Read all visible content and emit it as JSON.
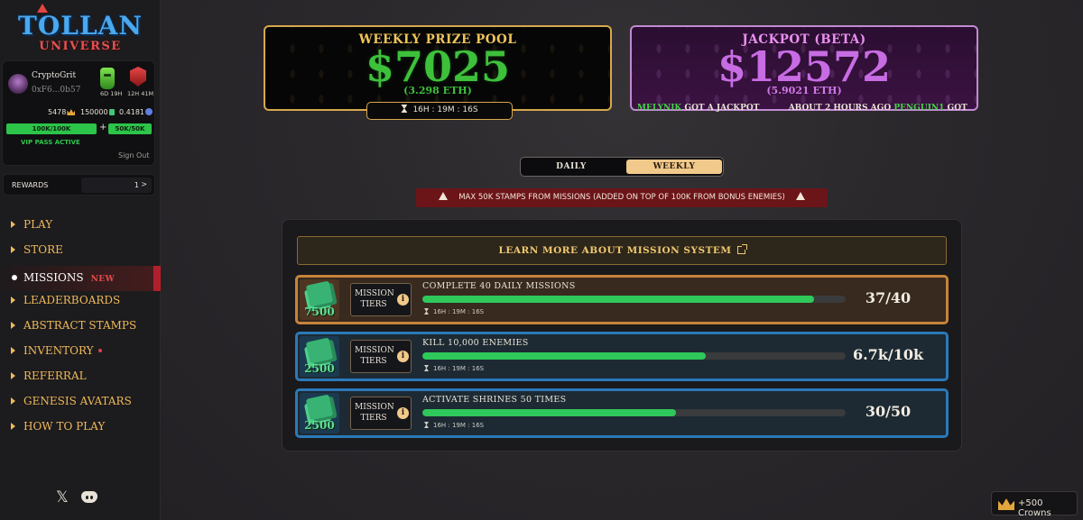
{
  "brand": {
    "title": "TOLLAN",
    "subtitle": "UNIVERSE"
  },
  "profile": {
    "username": "CryptoGrit",
    "wallet": "0xF6...0b57",
    "timer_green": "6D 19H",
    "timer_red": "12H 41M",
    "crowns": "5478",
    "stamps": "150000",
    "eth": "0.4181",
    "stamps_cap_1": "100K/100K",
    "stamps_cap_2": "50K/50K",
    "plus": "+",
    "vip": "VIP PASS ACTIVE",
    "sign_out": "Sign Out"
  },
  "rewards": {
    "label": "REWARDS",
    "count": "1",
    "chevron": ">"
  },
  "nav": {
    "play": "PLAY",
    "store": "STORE",
    "missions": "MISSIONS",
    "missions_badge": "NEW",
    "leaderboards": "LEADERBOARDS",
    "abstract_stamps": "ABSTRACT STAMPS",
    "inventory": "INVENTORY",
    "referral": "REFERRAL",
    "genesis_avatars": "GENESIS AVATARS",
    "how_to_play": "HOW TO PLAY"
  },
  "social": {
    "x": "𝕏"
  },
  "weekly_pool": {
    "title": "WEEKLY PRIZE POOL",
    "amount": "$7025",
    "eth": "(3.298 ETH)",
    "timer": "16H : 19M : 16S"
  },
  "jackpot": {
    "title": "JACKPOT (BETA)",
    "amount": "$12572",
    "eth": "(5.9021 ETH)",
    "ticker_name_1": "MELYNIK",
    "ticker_text_1": " GOT A JACKPOT",
    "ticker_time_1": "ABOUT 2 HOURS AGO",
    "ticker_name_2": "PENGUIN1",
    "ticker_text_2": " GOT"
  },
  "toggle": {
    "daily": "DAILY",
    "weekly": "WEEKLY",
    "selected": "WEEKLY"
  },
  "warning": "MAX 50K STAMPS FROM MISSIONS (ADDED ON TOP OF 100K FROM BONUS ENEMIES)",
  "learn_more": "LEARN MORE ABOUT MISSION SYSTEM",
  "missions": [
    {
      "reward": "7500",
      "tiers_label": "MISSION TIERS",
      "info": "i",
      "title": "COMPLETE 40 DAILY MISSIONS",
      "progress": 0.925,
      "timer": "16H : 19M : 16S",
      "count": "37/40",
      "color": "#c7833a"
    },
    {
      "reward": "2500",
      "tiers_label": "MISSION TIERS",
      "info": "i",
      "title": "KILL 10,000 ENEMIES",
      "progress": 0.67,
      "timer": "16H : 19M : 16S",
      "count": "6.7k/10k",
      "color": "#2a7ab8"
    },
    {
      "reward": "2500",
      "tiers_label": "MISSION TIERS",
      "info": "i",
      "title": "ACTIVATE SHRINES 50 TIMES",
      "progress": 0.6,
      "timer": "16H : 19M : 16S",
      "count": "30/50",
      "color": "#2a7ab8"
    }
  ],
  "toast": {
    "text": "+500 Crowns"
  },
  "colors": {
    "accent_gold": "#f0b95b",
    "weekly_green": "#3dc13b",
    "jackpot_purple": "#c86ce4",
    "progress_green": "#2fc85a",
    "warning_red": "#6b1519"
  }
}
